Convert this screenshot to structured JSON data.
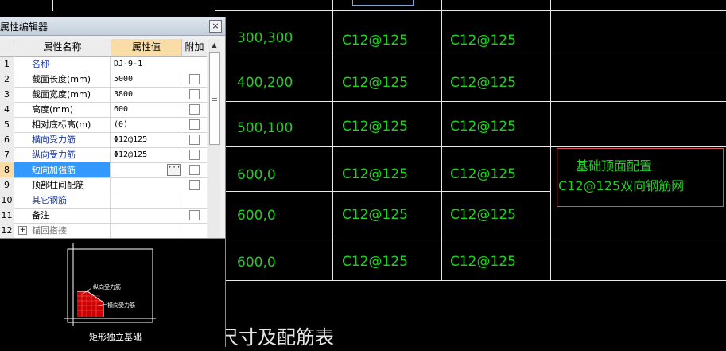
{
  "panel": {
    "title": "属性编辑器",
    "close": "×",
    "headers": {
      "name": "属性名称",
      "value": "属性值",
      "extra": "附加"
    },
    "rows": [
      {
        "num": "1",
        "name": "名称",
        "value": "DJ-9-1",
        "color": "blue",
        "check": false
      },
      {
        "num": "2",
        "name": "截面长度(mm)",
        "value": "5000",
        "color": "black",
        "check": true
      },
      {
        "num": "3",
        "name": "截面宽度(mm)",
        "value": "3800",
        "color": "black",
        "check": true
      },
      {
        "num": "4",
        "name": "高度(mm)",
        "value": "600",
        "color": "black",
        "check": true
      },
      {
        "num": "5",
        "name": "相对底标高(m)",
        "value": "(0)",
        "color": "black",
        "check": true
      },
      {
        "num": "6",
        "name": "横向受力筋",
        "value": "Φ12@125",
        "color": "blue",
        "check": true
      },
      {
        "num": "7",
        "name": "纵向受力筋",
        "value": "Φ12@125",
        "color": "blue",
        "check": true
      },
      {
        "num": "8",
        "name": "短向加强筋",
        "value": "",
        "color": "black",
        "check": true
      },
      {
        "num": "9",
        "name": "顶部柱间配筋",
        "value": "",
        "color": "black",
        "check": true
      },
      {
        "num": "10",
        "name": "其它钢筋",
        "value": "",
        "color": "blue",
        "check": false
      },
      {
        "num": "11",
        "name": "备注",
        "value": "",
        "color": "black",
        "check": true
      },
      {
        "num": "12",
        "name": "锚固搭接",
        "value": "",
        "color": "gray",
        "check": false
      }
    ],
    "ellipsis": "···",
    "plus": "+",
    "preview": {
      "caption": "矩形独立基础",
      "label_a": "纵向受力筋",
      "label_b": "横向受力筋"
    }
  },
  "cad": {
    "rows": [
      {
        "size": "300,300",
        "rebar1": "C12@125",
        "rebar2": "C12@125"
      },
      {
        "size": "400,200",
        "rebar1": "C12@125",
        "rebar2": "C12@125"
      },
      {
        "size": "500,100",
        "rebar1": "C12@125",
        "rebar2": "C12@125"
      },
      {
        "size": "600,0",
        "rebar1": "C12@125",
        "rebar2": "C12@125"
      },
      {
        "size": "600,0",
        "rebar1": "C12@125",
        "rebar2": "C12@125"
      },
      {
        "size": "600,0",
        "rebar1": "C12@125",
        "rebar2": "C12@125"
      }
    ],
    "note_line1": "基础顶面配置",
    "note_line2": "C12@125双向钢筋网",
    "title_fragment": "尺寸及配筋表"
  },
  "colors": {
    "cad_text": "#1ed21e",
    "selection": "#3399ff",
    "value_header": "#f9dca6",
    "note_border": "#d9534f"
  }
}
